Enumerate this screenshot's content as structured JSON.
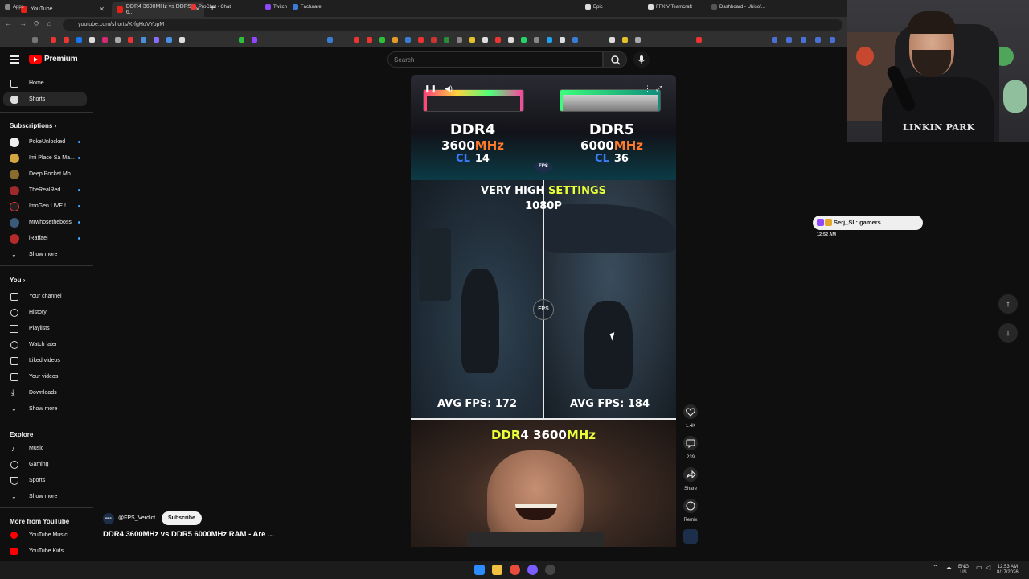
{
  "browser": {
    "tabs": [
      {
        "title": "YouTube",
        "active": false
      },
      {
        "title": "DDR4 3600MHz vs DDR5 6...",
        "active": true
      }
    ],
    "url": "youtube.com/shorts/K-fgHuVYppM",
    "bookmarks": {
      "apps": "Apps",
      "prochat": "ProChat - Chat",
      "twitch": "Twitch",
      "facturare": "Facturare",
      "epic": "Epic",
      "ffxiv": "FFXIV Teamcraft",
      "dashboard": "Dashboard - Ubisof..."
    }
  },
  "header": {
    "logo_text": "Premium",
    "search_placeholder": "Search"
  },
  "sidebar": {
    "home": "Home",
    "shorts": "Shorts",
    "subscriptions_heading": "Subscriptions",
    "subscriptions": [
      {
        "name": "PokeUnlocked",
        "color": "#eeeeee"
      },
      {
        "name": "Imi Place Sa Ma...",
        "color": "#d4a640"
      },
      {
        "name": "Deep Pocket Mo...",
        "color": "#8a6d2d"
      },
      {
        "name": "TheRealRed",
        "color": "#9c2a2a"
      },
      {
        "name": "ImoGen LIVE !",
        "color": "#222222"
      },
      {
        "name": "Mrwhosetheboss",
        "color": "#3a5a7a"
      },
      {
        "name": "lRaffael",
        "color": "#b52a2a"
      }
    ],
    "show_more_1": "Show more",
    "you_heading": "You",
    "you_items": [
      "Your channel",
      "History",
      "Playlists",
      "Watch later",
      "Liked videos",
      "Your videos",
      "Downloads"
    ],
    "show_more_2": "Show more",
    "explore_heading": "Explore",
    "explore_items": [
      "Music",
      "Gaming",
      "Sports"
    ],
    "show_more_3": "Show more",
    "more_heading": "More from YouTube",
    "more_items": [
      "YouTube Music",
      "YouTube Kids"
    ]
  },
  "short": {
    "left": {
      "type": "DDR4",
      "freq_num": "3600",
      "freq_unit": "MHz",
      "cl_label": "CL",
      "cl_value": "14"
    },
    "right": {
      "type": "DDR5",
      "freq_num": "6000",
      "freq_unit": "MHz",
      "cl_label": "CL",
      "cl_value": "36"
    },
    "settings_a": "VERY HIGH ",
    "settings_b": "SETTINGS",
    "resolution": "1080P",
    "fps_label": "AVG FPS:",
    "fps_left": "172",
    "fps_right": "184",
    "logo": "FPS",
    "meme_a": "DDR",
    "meme_b": "4 ",
    "meme_c": "3600",
    "meme_d": "MHz"
  },
  "actions": {
    "likes": "1.4K",
    "comments": "239",
    "share": "Share",
    "remix": "Remix"
  },
  "channel": {
    "handle": "@FPS_Verdict",
    "subscribe": "Subscribe",
    "video_title": "DDR4 3600MHz vs DDR5 6000MHz RAM - Are ..."
  },
  "overlay": {
    "notification": "Serj_Sl : gamers",
    "notification_time": "12:52 AM",
    "shirt_text": "LINKIN PARK"
  },
  "taskbar": {
    "lang": "ENG",
    "region": "US",
    "time": "12:53 AM",
    "date": "8/17/2026"
  }
}
